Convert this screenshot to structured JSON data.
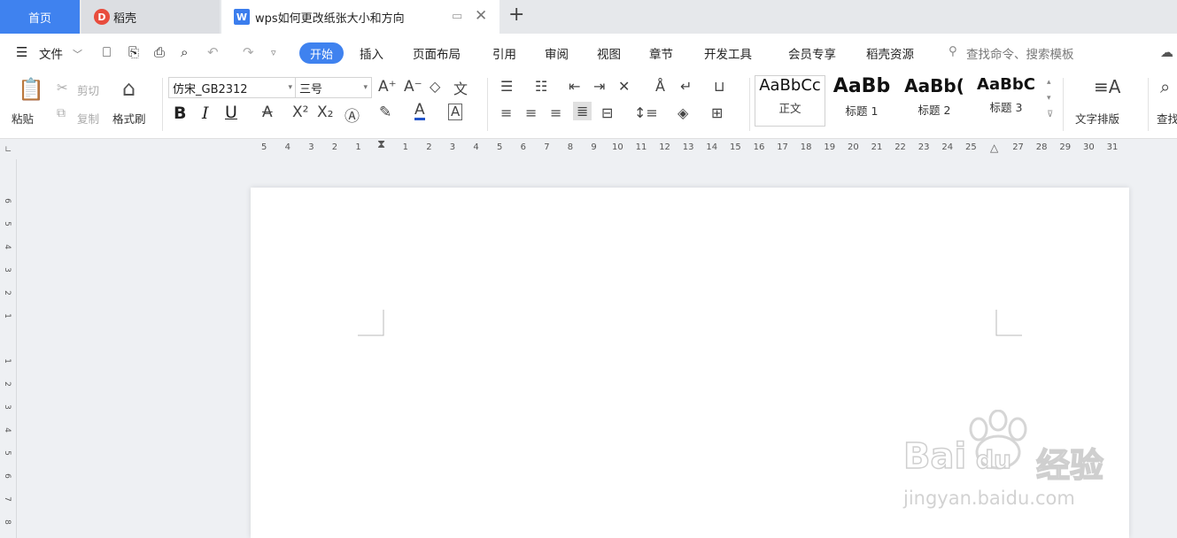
{
  "tabs": {
    "home": "首页",
    "daoke": "稻壳",
    "doc_title": "wps如何更改纸张大小和方向",
    "add": "+"
  },
  "menu": {
    "file": "文件",
    "items": [
      "开始",
      "插入",
      "页面布局",
      "引用",
      "审阅",
      "视图",
      "章节",
      "开发工具",
      "会员专享",
      "稻壳资源"
    ],
    "search_placeholder": "查找命令、搜索模板"
  },
  "ribbon": {
    "paste": "粘贴",
    "cut": "剪切",
    "copy": "复制",
    "format_painter": "格式刷",
    "font_name": "仿宋_GB2312",
    "font_size": "三号",
    "styles": [
      {
        "sample": "AaBbCc",
        "label": "正文"
      },
      {
        "sample": "AaBb",
        "label": "标题 1"
      },
      {
        "sample": "AaBb(",
        "label": "标题 2"
      },
      {
        "sample": "AaBbC",
        "label": "标题 3"
      }
    ],
    "text_layout": "文字排版",
    "find": "查找"
  },
  "ruler": {
    "h_ticks": [
      "5",
      "4",
      "3",
      "2",
      "1",
      "",
      "1",
      "2",
      "3",
      "4",
      "5",
      "6",
      "7",
      "8",
      "9",
      "10",
      "11",
      "12",
      "13",
      "14",
      "15",
      "16",
      "17",
      "18",
      "19",
      "20",
      "21",
      "22",
      "23",
      "24",
      "25",
      "",
      "27",
      "28",
      "29",
      "30",
      "31"
    ],
    "v_ticks": [
      "6",
      "5",
      "4",
      "3",
      "2",
      "1",
      "",
      "1",
      "2",
      "3",
      "4",
      "5",
      "6",
      "7",
      "8"
    ]
  },
  "watermark": {
    "brand": "Bai",
    "brand2": "du",
    "cn": "经验",
    "url": "jingyan.baidu.com"
  },
  "colors": {
    "accent": "#3f82ef"
  }
}
